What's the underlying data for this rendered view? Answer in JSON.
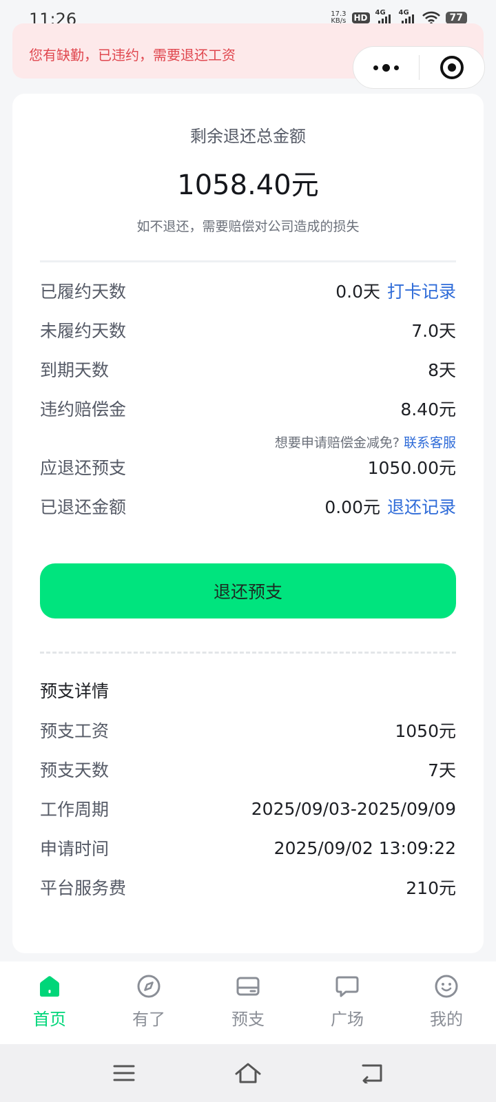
{
  "status_bar": {
    "time": "11:26",
    "net_speed_value": "17.3",
    "net_speed_unit": "KB/s",
    "hd_label": "HD",
    "sim1_label": "4G",
    "sim2_label": "4G",
    "battery": "77"
  },
  "alert": {
    "text": "您有缺勤，已违约，需要退还工资",
    "color": "#e0474f"
  },
  "summary": {
    "label": "剩余退还总金额",
    "amount": "1058.40元",
    "note": "如不退还，需要赔偿对公司造成的损失"
  },
  "details": {
    "fulfilled_days": {
      "label": "已履约天数",
      "value": "0.0天",
      "link": "打卡记录"
    },
    "unfulfilled_days": {
      "label": "未履约天数",
      "value": "7.0天"
    },
    "days_to_due": {
      "label": "到期天数",
      "value": "8天"
    },
    "penalty": {
      "label": "违约赔偿金",
      "value": "8.40元"
    },
    "penalty_hint": {
      "text": "想要申请赔偿金减免?",
      "link": "联系客服"
    },
    "advance_to_return": {
      "label": "应退还预支",
      "value": "1050.00元"
    },
    "returned_amount": {
      "label": "已退还金额",
      "value": "0.00元",
      "link": "退还记录"
    }
  },
  "return_button": {
    "label": "退还预支",
    "color": "#00e47e"
  },
  "advance_details": {
    "title": "预支详情",
    "rows": [
      {
        "label": "预支工资",
        "value": "1050元"
      },
      {
        "label": "预支天数",
        "value": "7天"
      },
      {
        "label": "工作周期",
        "value": "2025/09/03-2025/09/09"
      },
      {
        "label": "申请时间",
        "value": "2025/09/02 13:09:22"
      },
      {
        "label": "平台服务费",
        "value": "210元"
      }
    ]
  },
  "tabbar": {
    "active_color": "#00d679",
    "items": [
      {
        "label": "首页",
        "icon": "home-icon"
      },
      {
        "label": "有了",
        "icon": "compass-icon"
      },
      {
        "label": "预支",
        "icon": "wallet-icon"
      },
      {
        "label": "广场",
        "icon": "chat-bubble-icon"
      },
      {
        "label": "我的",
        "icon": "smiley-icon"
      }
    ]
  },
  "nav_bar": {
    "icons": [
      "menu-icon",
      "home-outline-icon",
      "back-icon"
    ]
  }
}
